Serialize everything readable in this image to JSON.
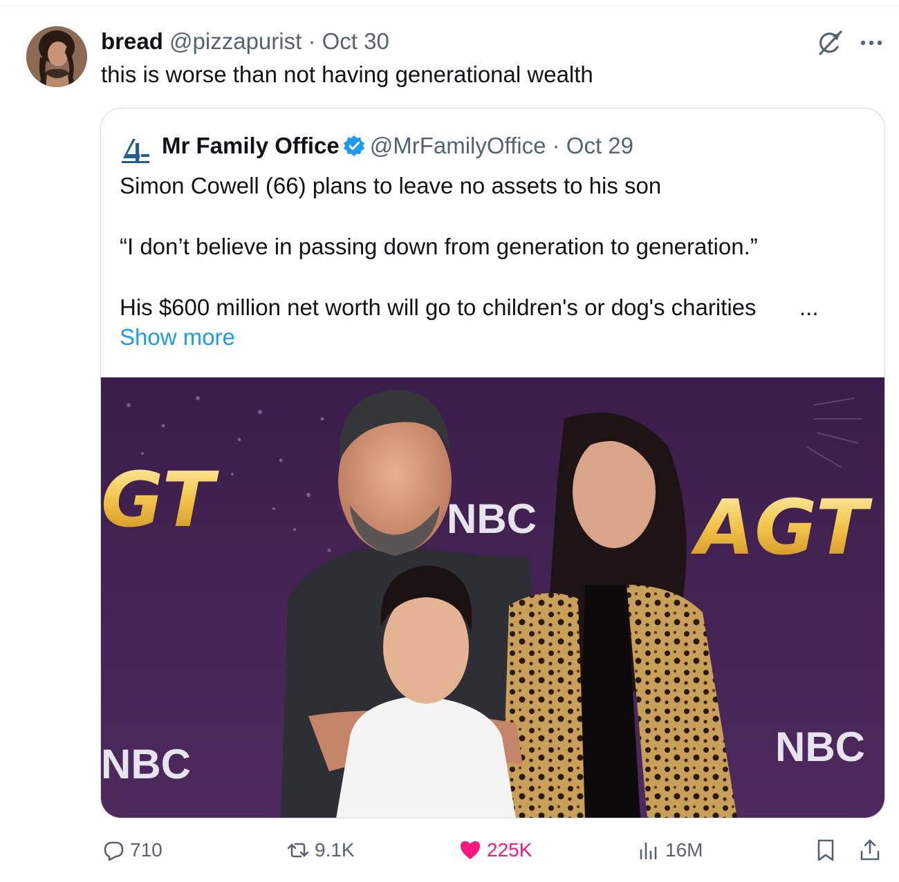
{
  "tweet": {
    "author_name": "bread",
    "handle_and_date": "@pizzapurist · Oct 30",
    "text": "this is worse than not having generational wealth"
  },
  "quote": {
    "author_name": "Mr Family Office",
    "handle_and_date": "@MrFamilyOffice · Oct 29",
    "line1": "Simon Cowell (66) plans to leave no assets to his son",
    "line2": " “I don’t believe in passing down from generation to generation.”",
    "line3": "His $600 million net worth will go to children's or dog's charities",
    "ellipsis": "...",
    "show_more": "Show more",
    "photo_texts": {
      "agt_left": "GT",
      "nbc_center": "NBC",
      "agt_right": "AGT",
      "nbc_left": "NBC",
      "nbc_right": "NBC"
    }
  },
  "actions": {
    "replies": "710",
    "reposts": "9.1K",
    "likes": "225K",
    "views": "16M"
  },
  "icons": [
    "grok-icon",
    "more-icon",
    "verified-badge-icon",
    "reply-icon",
    "repost-icon",
    "like-icon",
    "views-icon",
    "bookmark-icon",
    "share-icon"
  ],
  "colors": {
    "link": "#1d9bf0",
    "like": "#f91880",
    "secondary": "#536471",
    "verified": "#1d9bf0"
  }
}
